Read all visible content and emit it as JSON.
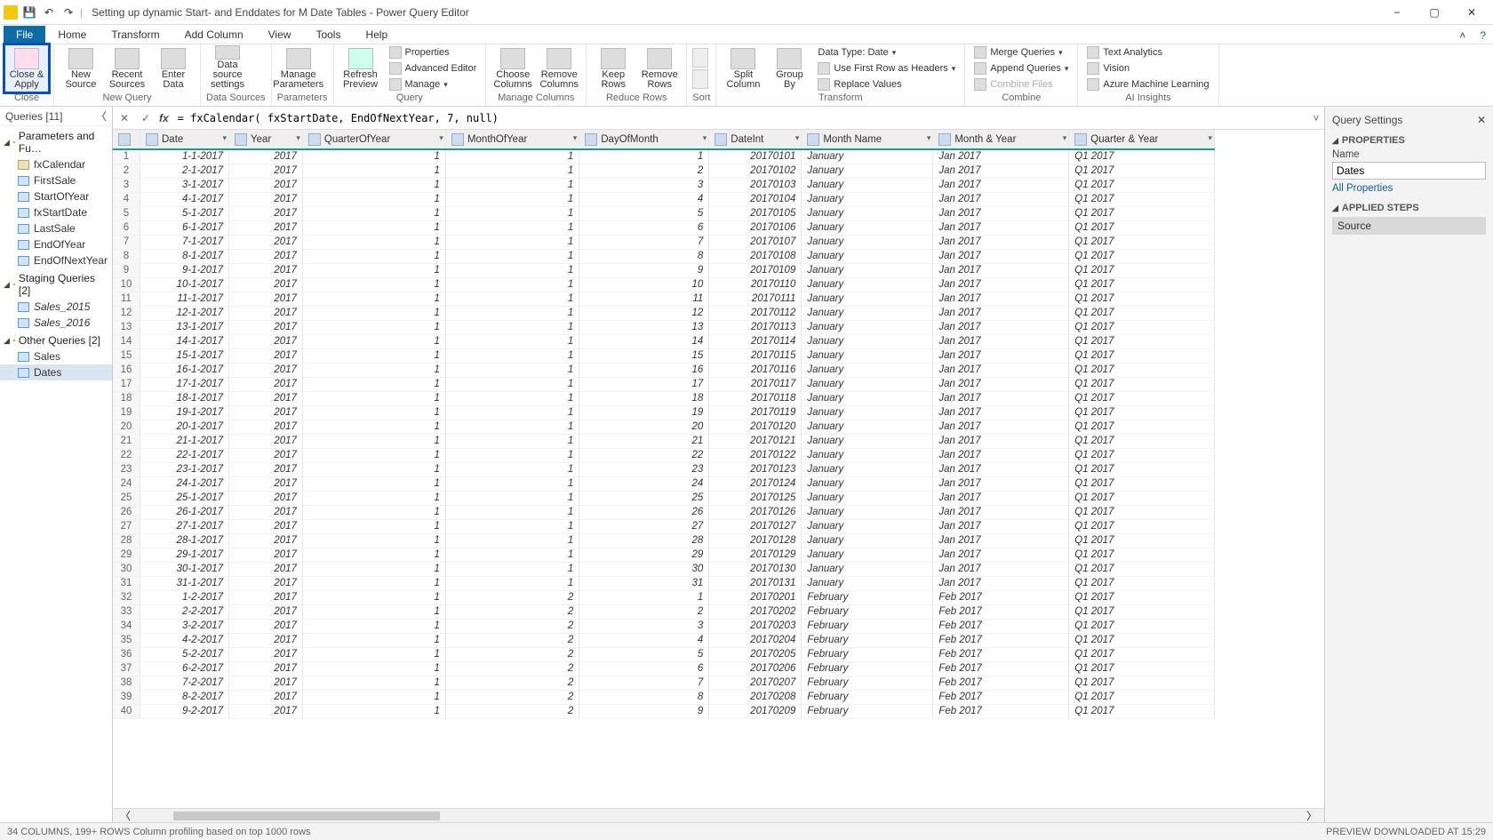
{
  "window_title": "Setting up dynamic Start- and Enddates for M Date Tables - Power Query Editor",
  "menubar": {
    "file": "File",
    "home": "Home",
    "transform": "Transform",
    "addcol": "Add Column",
    "view": "View",
    "tools": "Tools",
    "help": "Help"
  },
  "ribbon": {
    "close_apply": "Close &\nApply",
    "close_group": "Close",
    "new_source": "New\nSource",
    "recent_sources": "Recent\nSources",
    "enter_data": "Enter\nData",
    "newquery_group": "New Query",
    "ds_settings": "Data source\nsettings",
    "ds_group": "Data Sources",
    "manage_params": "Manage\nParameters",
    "params_group": "Parameters",
    "refresh": "Refresh\nPreview",
    "properties": "Properties",
    "adv_editor": "Advanced Editor",
    "manage": "Manage",
    "query_group": "Query",
    "choose_cols": "Choose\nColumns",
    "remove_cols": "Remove\nColumns",
    "mc_group": "Manage Columns",
    "keep_rows": "Keep\nRows",
    "remove_rows": "Remove\nRows",
    "rr_group": "Reduce Rows",
    "sort_group": "Sort",
    "split_col": "Split\nColumn",
    "group_by": "Group\nBy",
    "data_type": "Data Type: Date",
    "first_row": "Use First Row as Headers",
    "replace": "Replace Values",
    "transform_group": "Transform",
    "merge": "Merge Queries",
    "append": "Append Queries",
    "combine_files": "Combine Files",
    "combine_group": "Combine",
    "text_an": "Text Analytics",
    "vision": "Vision",
    "azml": "Azure Machine Learning",
    "ai_group": "AI Insights"
  },
  "queries_panel": {
    "title": "Queries [11]",
    "groups": [
      {
        "name": "Parameters and Fu…",
        "items": [
          {
            "name": "fxCalendar",
            "type": "fx"
          },
          {
            "name": "FirstSale",
            "type": "tbl"
          },
          {
            "name": "StartOfYear",
            "type": "tbl"
          },
          {
            "name": "fxStartDate",
            "type": "tbl"
          },
          {
            "name": "LastSale",
            "type": "tbl"
          },
          {
            "name": "EndOfYear",
            "type": "tbl"
          },
          {
            "name": "EndOfNextYear",
            "type": "tbl"
          }
        ]
      },
      {
        "name": "Staging Queries [2]",
        "items": [
          {
            "name": "Sales_2015",
            "type": "tbl",
            "italic": true
          },
          {
            "name": "Sales_2016",
            "type": "tbl",
            "italic": true
          }
        ]
      },
      {
        "name": "Other Queries [2]",
        "items": [
          {
            "name": "Sales",
            "type": "tbl"
          },
          {
            "name": "Dates",
            "type": "tbl",
            "selected": true
          }
        ]
      }
    ]
  },
  "formula": "= fxCalendar( fxStartDate, EndOfNextYear, 7, null)",
  "columns": [
    {
      "h": "Date",
      "type": "date"
    },
    {
      "h": "Year",
      "type": "num"
    },
    {
      "h": "QuarterOfYear",
      "type": "num"
    },
    {
      "h": "MonthOfYear",
      "type": "num"
    },
    {
      "h": "DayOfMonth",
      "type": "num"
    },
    {
      "h": "DateInt",
      "type": "num"
    },
    {
      "h": "Month Name",
      "type": "txt"
    },
    {
      "h": "Month & Year",
      "type": "txt"
    },
    {
      "h": "Quarter & Year",
      "type": "txt"
    }
  ],
  "rows": [
    [
      "1-1-2017",
      "2017",
      "1",
      "1",
      "1",
      "20170101",
      "January",
      "Jan 2017",
      "Q1 2017"
    ],
    [
      "2-1-2017",
      "2017",
      "1",
      "1",
      "2",
      "20170102",
      "January",
      "Jan 2017",
      "Q1 2017"
    ],
    [
      "3-1-2017",
      "2017",
      "1",
      "1",
      "3",
      "20170103",
      "January",
      "Jan 2017",
      "Q1 2017"
    ],
    [
      "4-1-2017",
      "2017",
      "1",
      "1",
      "4",
      "20170104",
      "January",
      "Jan 2017",
      "Q1 2017"
    ],
    [
      "5-1-2017",
      "2017",
      "1",
      "1",
      "5",
      "20170105",
      "January",
      "Jan 2017",
      "Q1 2017"
    ],
    [
      "6-1-2017",
      "2017",
      "1",
      "1",
      "6",
      "20170106",
      "January",
      "Jan 2017",
      "Q1 2017"
    ],
    [
      "7-1-2017",
      "2017",
      "1",
      "1",
      "7",
      "20170107",
      "January",
      "Jan 2017",
      "Q1 2017"
    ],
    [
      "8-1-2017",
      "2017",
      "1",
      "1",
      "8",
      "20170108",
      "January",
      "Jan 2017",
      "Q1 2017"
    ],
    [
      "9-1-2017",
      "2017",
      "1",
      "1",
      "9",
      "20170109",
      "January",
      "Jan 2017",
      "Q1 2017"
    ],
    [
      "10-1-2017",
      "2017",
      "1",
      "1",
      "10",
      "20170110",
      "January",
      "Jan 2017",
      "Q1 2017"
    ],
    [
      "11-1-2017",
      "2017",
      "1",
      "1",
      "11",
      "20170111",
      "January",
      "Jan 2017",
      "Q1 2017"
    ],
    [
      "12-1-2017",
      "2017",
      "1",
      "1",
      "12",
      "20170112",
      "January",
      "Jan 2017",
      "Q1 2017"
    ],
    [
      "13-1-2017",
      "2017",
      "1",
      "1",
      "13",
      "20170113",
      "January",
      "Jan 2017",
      "Q1 2017"
    ],
    [
      "14-1-2017",
      "2017",
      "1",
      "1",
      "14",
      "20170114",
      "January",
      "Jan 2017",
      "Q1 2017"
    ],
    [
      "15-1-2017",
      "2017",
      "1",
      "1",
      "15",
      "20170115",
      "January",
      "Jan 2017",
      "Q1 2017"
    ],
    [
      "16-1-2017",
      "2017",
      "1",
      "1",
      "16",
      "20170116",
      "January",
      "Jan 2017",
      "Q1 2017"
    ],
    [
      "17-1-2017",
      "2017",
      "1",
      "1",
      "17",
      "20170117",
      "January",
      "Jan 2017",
      "Q1 2017"
    ],
    [
      "18-1-2017",
      "2017",
      "1",
      "1",
      "18",
      "20170118",
      "January",
      "Jan 2017",
      "Q1 2017"
    ],
    [
      "19-1-2017",
      "2017",
      "1",
      "1",
      "19",
      "20170119",
      "January",
      "Jan 2017",
      "Q1 2017"
    ],
    [
      "20-1-2017",
      "2017",
      "1",
      "1",
      "20",
      "20170120",
      "January",
      "Jan 2017",
      "Q1 2017"
    ],
    [
      "21-1-2017",
      "2017",
      "1",
      "1",
      "21",
      "20170121",
      "January",
      "Jan 2017",
      "Q1 2017"
    ],
    [
      "22-1-2017",
      "2017",
      "1",
      "1",
      "22",
      "20170122",
      "January",
      "Jan 2017",
      "Q1 2017"
    ],
    [
      "23-1-2017",
      "2017",
      "1",
      "1",
      "23",
      "20170123",
      "January",
      "Jan 2017",
      "Q1 2017"
    ],
    [
      "24-1-2017",
      "2017",
      "1",
      "1",
      "24",
      "20170124",
      "January",
      "Jan 2017",
      "Q1 2017"
    ],
    [
      "25-1-2017",
      "2017",
      "1",
      "1",
      "25",
      "20170125",
      "January",
      "Jan 2017",
      "Q1 2017"
    ],
    [
      "26-1-2017",
      "2017",
      "1",
      "1",
      "26",
      "20170126",
      "January",
      "Jan 2017",
      "Q1 2017"
    ],
    [
      "27-1-2017",
      "2017",
      "1",
      "1",
      "27",
      "20170127",
      "January",
      "Jan 2017",
      "Q1 2017"
    ],
    [
      "28-1-2017",
      "2017",
      "1",
      "1",
      "28",
      "20170128",
      "January",
      "Jan 2017",
      "Q1 2017"
    ],
    [
      "29-1-2017",
      "2017",
      "1",
      "1",
      "29",
      "20170129",
      "January",
      "Jan 2017",
      "Q1 2017"
    ],
    [
      "30-1-2017",
      "2017",
      "1",
      "1",
      "30",
      "20170130",
      "January",
      "Jan 2017",
      "Q1 2017"
    ],
    [
      "31-1-2017",
      "2017",
      "1",
      "1",
      "31",
      "20170131",
      "January",
      "Jan 2017",
      "Q1 2017"
    ],
    [
      "1-2-2017",
      "2017",
      "1",
      "2",
      "1",
      "20170201",
      "February",
      "Feb 2017",
      "Q1 2017"
    ],
    [
      "2-2-2017",
      "2017",
      "1",
      "2",
      "2",
      "20170202",
      "February",
      "Feb 2017",
      "Q1 2017"
    ],
    [
      "3-2-2017",
      "2017",
      "1",
      "2",
      "3",
      "20170203",
      "February",
      "Feb 2017",
      "Q1 2017"
    ],
    [
      "4-2-2017",
      "2017",
      "1",
      "2",
      "4",
      "20170204",
      "February",
      "Feb 2017",
      "Q1 2017"
    ],
    [
      "5-2-2017",
      "2017",
      "1",
      "2",
      "5",
      "20170205",
      "February",
      "Feb 2017",
      "Q1 2017"
    ],
    [
      "6-2-2017",
      "2017",
      "1",
      "2",
      "6",
      "20170206",
      "February",
      "Feb 2017",
      "Q1 2017"
    ],
    [
      "7-2-2017",
      "2017",
      "1",
      "2",
      "7",
      "20170207",
      "February",
      "Feb 2017",
      "Q1 2017"
    ],
    [
      "8-2-2017",
      "2017",
      "1",
      "2",
      "8",
      "20170208",
      "February",
      "Feb 2017",
      "Q1 2017"
    ],
    [
      "9-2-2017",
      "2017",
      "1",
      "2",
      "9",
      "20170209",
      "February",
      "Feb 2017",
      "Q1 2017"
    ]
  ],
  "settings": {
    "title": "Query Settings",
    "properties": "PROPERTIES",
    "name_label": "Name",
    "name_value": "Dates",
    "all_props": "All Properties",
    "applied": "APPLIED STEPS",
    "step_source": "Source"
  },
  "status": {
    "left": "34 COLUMNS, 199+ ROWS    Column profiling based on top 1000 rows",
    "right": "PREVIEW DOWNLOADED AT 15:29"
  }
}
